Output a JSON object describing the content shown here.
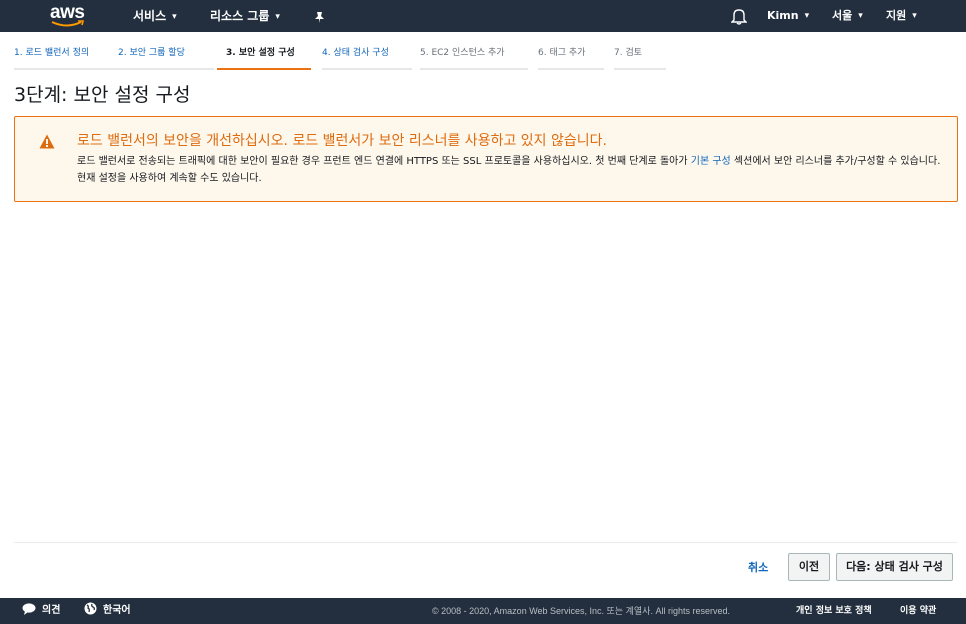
{
  "header": {
    "logo_text": "aws",
    "services_label": "서비스",
    "resource_groups_label": "리소스 그룹",
    "user_label": "Kimn",
    "region_label": "서울",
    "support_label": "지원"
  },
  "wizard": {
    "tabs": [
      {
        "label": "1. 로드 밸런서 정의",
        "state": "link"
      },
      {
        "label": "2. 보안 그룹 할당",
        "state": "link"
      },
      {
        "label": "3. 보안 설정 구성",
        "state": "active"
      },
      {
        "label": "4. 상태 검사 구성",
        "state": "link"
      },
      {
        "label": "5. EC2 인스턴스 추가",
        "state": "disabled"
      },
      {
        "label": "6. 태그 추가",
        "state": "disabled"
      },
      {
        "label": "7. 검토",
        "state": "disabled"
      }
    ]
  },
  "page": {
    "title": "3단계: 보안 설정 구성"
  },
  "warning": {
    "title": "로드 밸런서의 보안을 개선하십시오. 로드 밸런서가 보안 리스너를 사용하고 있지 않습니다.",
    "body_part1": "로드 밸런서로 전송되는 트래픽에 대한 보안이 필요한 경우 프런트 엔드 연결에 HTTPS 또는 SSL 프로토콜을 사용하십시오. 첫 번째 단계로 돌아가 ",
    "body_link": "기본 구성",
    "body_part2": " 섹션에서 보안 리스너를 추가/구성할 수 있습니다. 현재 설정을 사용하여 계속할 수도 있습니다."
  },
  "actions": {
    "cancel_label": "취소",
    "previous_label": "이전",
    "next_label": "다음: 상태 검사 구성"
  },
  "footer": {
    "feedback_label": "의견",
    "language_label": "한국어",
    "copyright": "© 2008 - 2020, Amazon Web Services, Inc. 또는 계열사. All rights reserved.",
    "privacy_label": "개인 정보 보호 정책",
    "terms_label": "이용 약관"
  },
  "colors": {
    "nav_bg": "#232f3e",
    "accent_orange": "#ec7211",
    "link_blue": "#1166bb",
    "warning_bg": "#fef8ec",
    "warning_text": "#dd6b10"
  },
  "icons": [
    "aws-logo",
    "chevron-down-icon",
    "pin-icon",
    "bell-icon",
    "warning-icon",
    "speech-bubble-icon",
    "globe-icon"
  ]
}
